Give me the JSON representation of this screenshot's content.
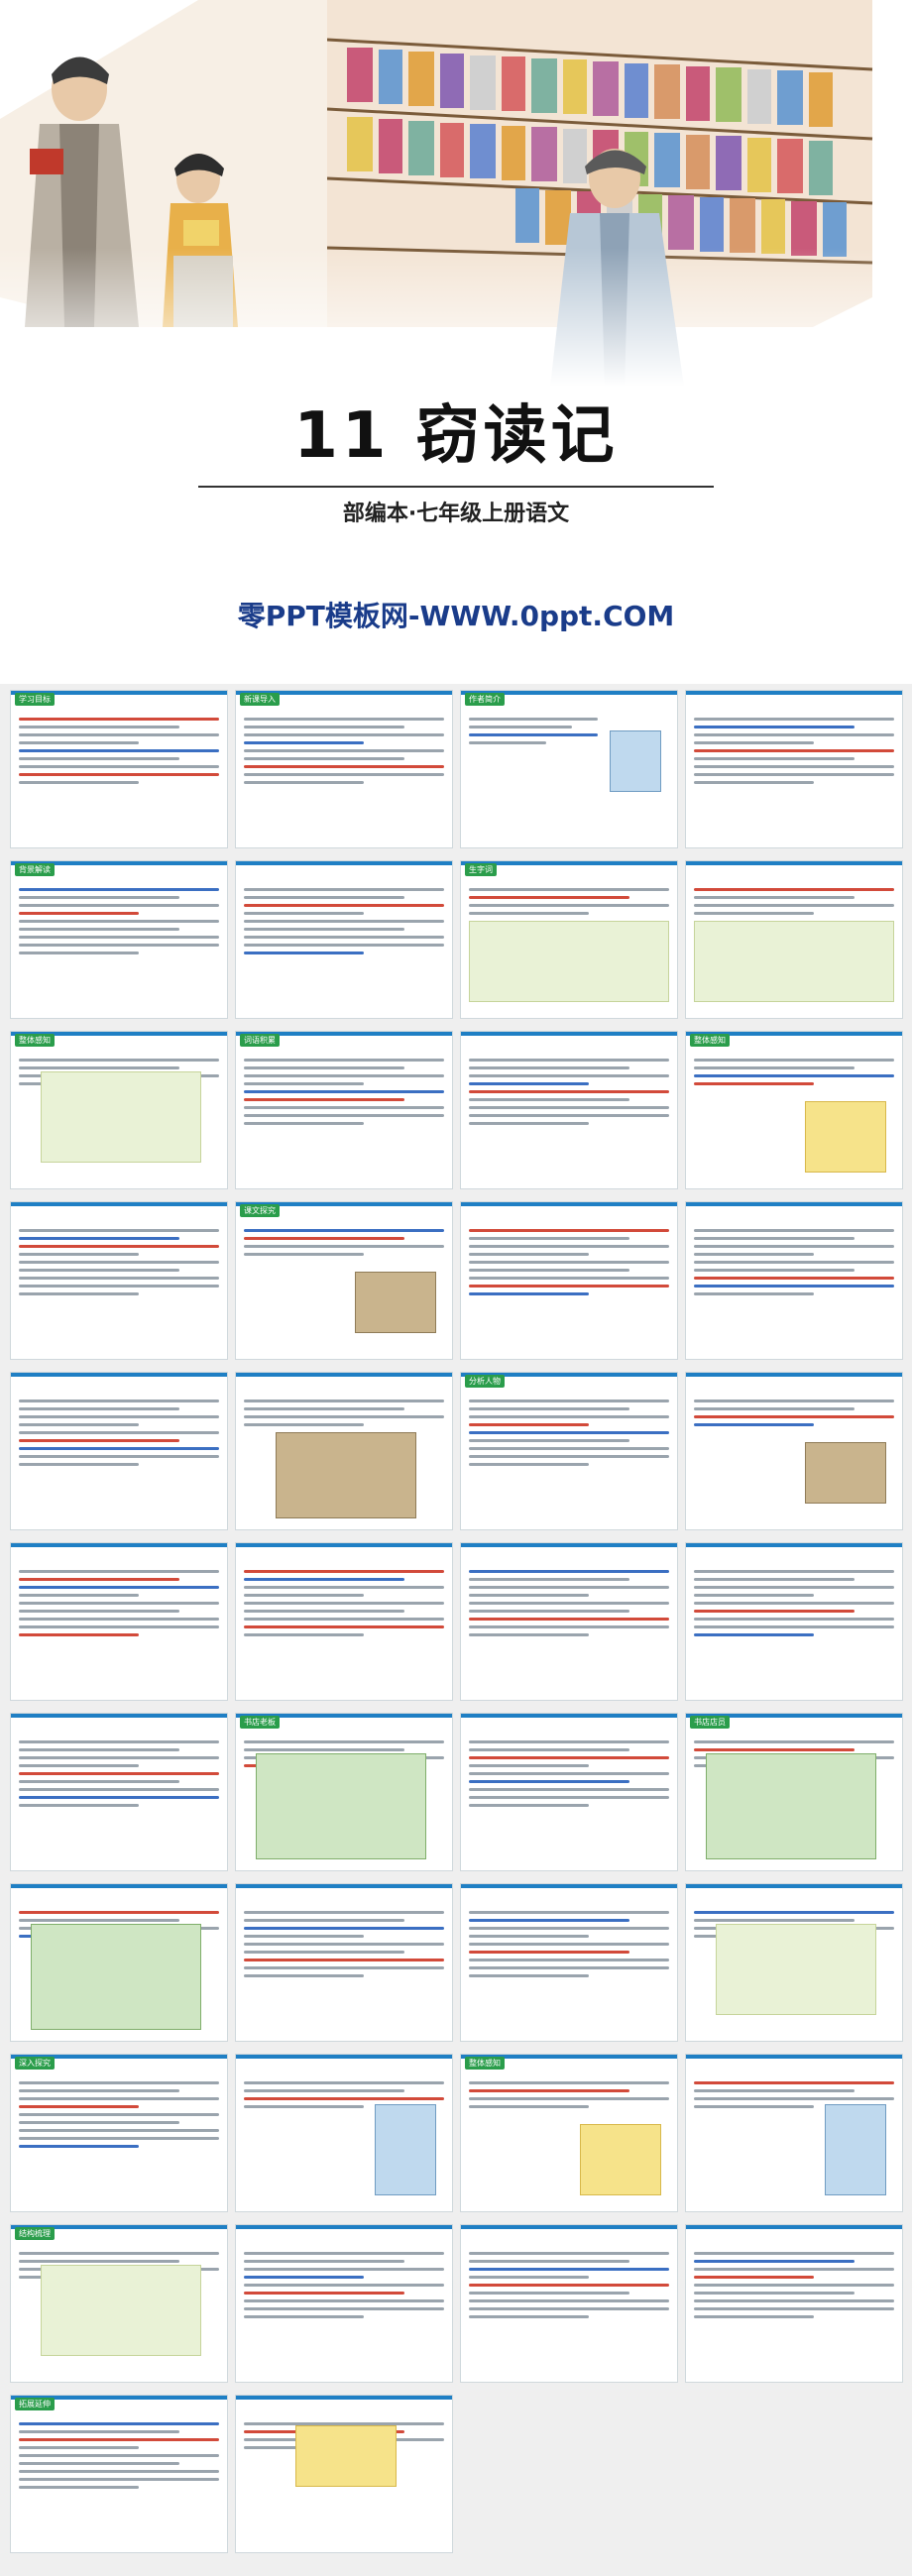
{
  "cover": {
    "title": "11 窃读记",
    "subtitle": "部编本·七年级上册语文",
    "site": "零PPT模板网-WWW.0ppt.COM"
  },
  "slides": [
    {
      "tab": "学习目标"
    },
    {
      "tab": "新课导入"
    },
    {
      "tab": "作者简介"
    },
    {
      "tab": ""
    },
    {
      "tab": "背景解读"
    },
    {
      "tab": ""
    },
    {
      "tab": "生字词"
    },
    {
      "tab": ""
    },
    {
      "tab": "整体感知"
    },
    {
      "tab": "词语积累"
    },
    {
      "tab": ""
    },
    {
      "tab": "整体感知"
    },
    {
      "tab": ""
    },
    {
      "tab": "课文探究"
    },
    {
      "tab": ""
    },
    {
      "tab": ""
    },
    {
      "tab": ""
    },
    {
      "tab": ""
    },
    {
      "tab": "分析人物"
    },
    {
      "tab": ""
    },
    {
      "tab": ""
    },
    {
      "tab": ""
    },
    {
      "tab": ""
    },
    {
      "tab": ""
    },
    {
      "tab": ""
    },
    {
      "tab": "书店老板"
    },
    {
      "tab": ""
    },
    {
      "tab": "书店店员"
    },
    {
      "tab": ""
    },
    {
      "tab": ""
    },
    {
      "tab": ""
    },
    {
      "tab": ""
    },
    {
      "tab": "深入探究"
    },
    {
      "tab": ""
    },
    {
      "tab": "整体感知"
    },
    {
      "tab": ""
    },
    {
      "tab": "结构梳理"
    },
    {
      "tab": ""
    },
    {
      "tab": ""
    },
    {
      "tab": ""
    },
    {
      "tab": "拓展延伸"
    },
    {
      "tab": ""
    }
  ]
}
